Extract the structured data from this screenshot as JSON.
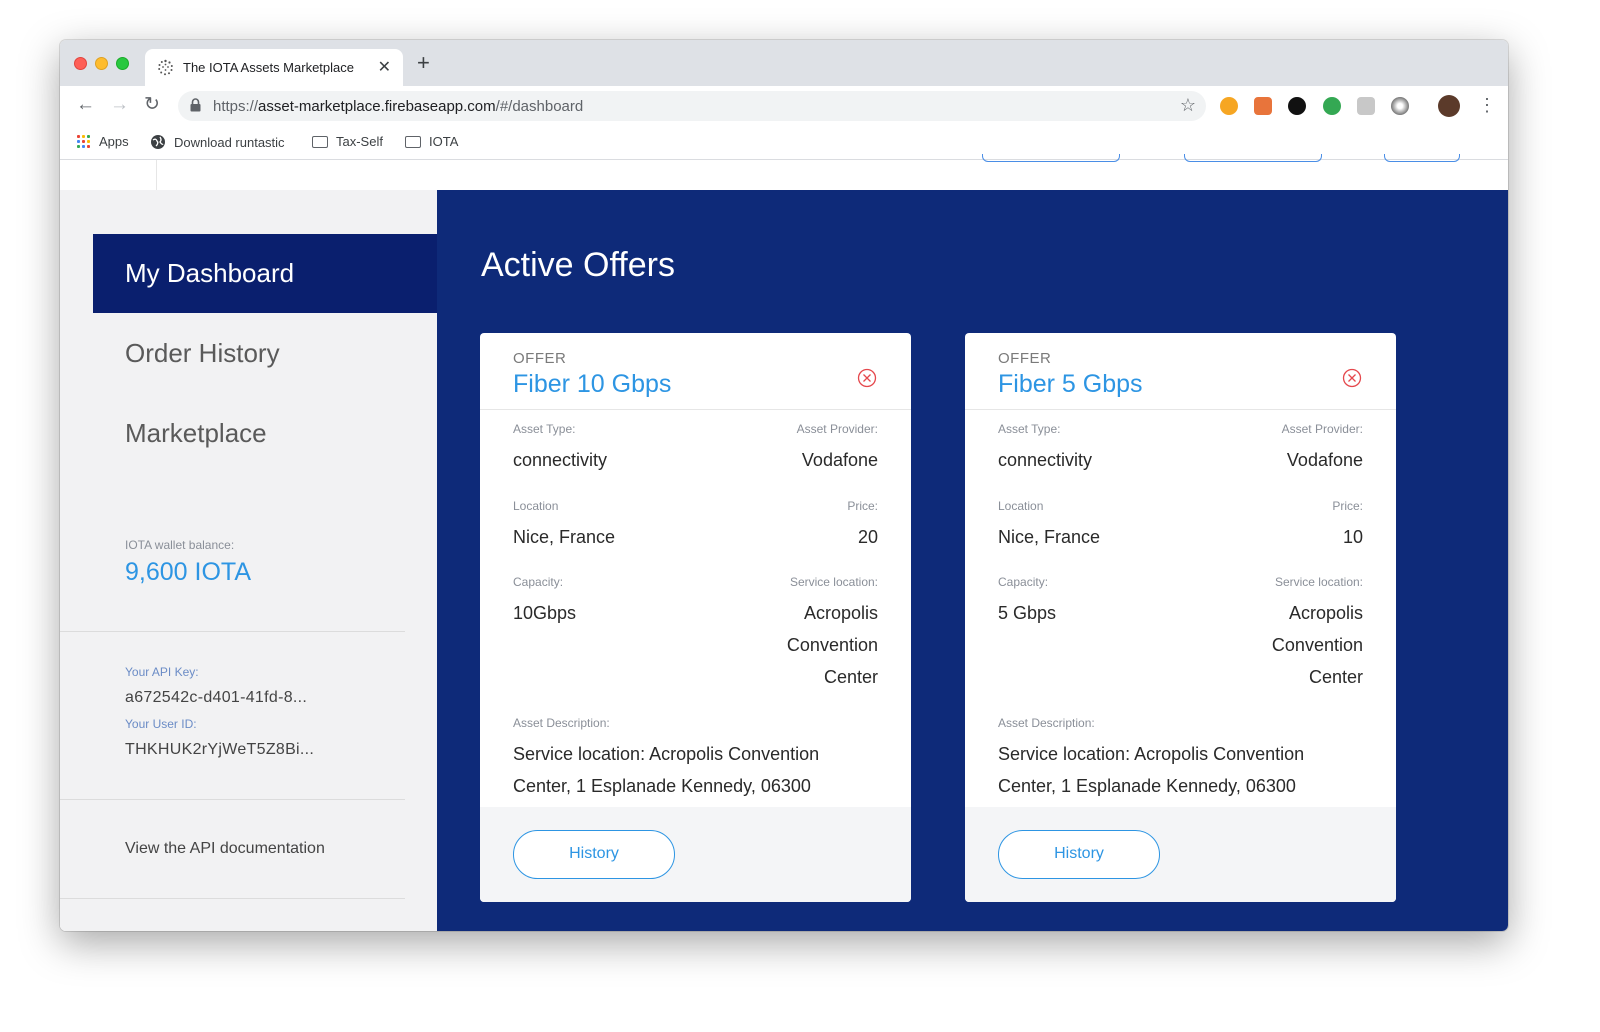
{
  "browser": {
    "tab_title": "The IOTA Assets Marketplace",
    "url_scheme": "https://",
    "url_host": "asset-marketplace.firebaseapp.com",
    "url_path": "/#/dashboard",
    "bookmarks": [
      {
        "label": "Apps",
        "icon": "apps-grid-icon"
      },
      {
        "label": "Download runtastic",
        "icon": "globe-icon"
      },
      {
        "label": "Tax-Self",
        "icon": "folder-icon"
      },
      {
        "label": "IOTA",
        "icon": "folder-icon"
      }
    ]
  },
  "sidebar": {
    "nav": [
      {
        "label": "My Dashboard",
        "active": true
      },
      {
        "label": "Order History",
        "active": false
      },
      {
        "label": "Marketplace",
        "active": false
      }
    ],
    "wallet_label": "IOTA wallet balance:",
    "wallet_value": "9,600 IOTA",
    "api_key_label": "Your API Key:",
    "api_key_value": "a672542c-d401-41fd-8...",
    "user_id_label": "Your User ID:",
    "user_id_value": "THKHUK2rYjWeT5Z8Bi...",
    "api_doc_link": "View the API documentation"
  },
  "main": {
    "title": "Active Offers",
    "offers": [
      {
        "kicker": "OFFER",
        "title": "Fiber 10 Gbps",
        "asset_type_label": "Asset Type:",
        "asset_type": "connectivity",
        "provider_label": "Asset Provider:",
        "provider": "Vodafone",
        "location_label": "Location",
        "location": "Nice, France",
        "price_label": "Price:",
        "price": "20",
        "capacity_label": "Capacity:",
        "capacity": "10Gbps",
        "service_location_label": "Service location:",
        "service_location": "Acropolis Convention Center",
        "description_label": "Asset Description:",
        "description": "Service location: Acropolis Convention Center, 1 Esplanade Kennedy, 06300",
        "history_label": "History"
      },
      {
        "kicker": "OFFER",
        "title": "Fiber 5 Gbps",
        "asset_type_label": "Asset Type:",
        "asset_type": "connectivity",
        "provider_label": "Asset Provider:",
        "provider": "Vodafone",
        "location_label": "Location",
        "location": "Nice, France",
        "price_label": "Price:",
        "price": "10",
        "capacity_label": "Capacity:",
        "capacity": "5 Gbps",
        "service_location_label": "Service location:",
        "service_location": "Acropolis Convention Center",
        "description_label": "Asset Description:",
        "description": "Service location: Acropolis Convention Center, 1 Esplanade Kennedy, 06300",
        "history_label": "History"
      }
    ]
  },
  "colors": {
    "sidebar_active": "#0a1f6e",
    "main_bg": "#0e2a79",
    "accent": "#2d95e3",
    "close_red": "#e5484d"
  }
}
